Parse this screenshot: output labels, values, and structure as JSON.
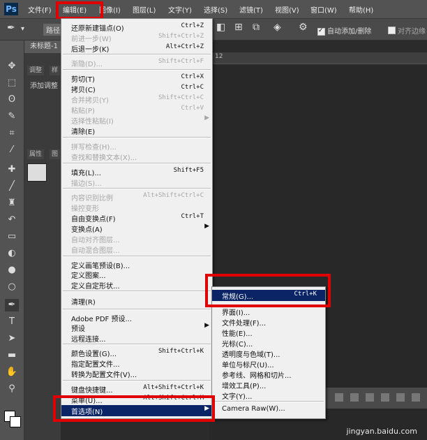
{
  "app": {
    "logo": "Ps"
  },
  "menubar": {
    "items": [
      "文件(F)",
      "编辑(E)",
      "图像(I)",
      "图层(L)",
      "文字(Y)",
      "选择(S)",
      "滤镜(T)",
      "视图(V)",
      "窗口(W)",
      "帮助(H)"
    ]
  },
  "options_bar": {
    "path_label": "路径",
    "auto_add_delete": "自动添加/删除",
    "align_edges": "对齐边缘"
  },
  "document": {
    "tab": "未标题-1",
    "ruler_mark": "12"
  },
  "panels": {
    "tab_adjust": "调整",
    "tab_style": "样",
    "add_adjust": "添加调整",
    "props_tab": "属性",
    "props_tab2": "图"
  },
  "edit_menu": {
    "items": [
      {
        "label": "还原新建锚点(O)",
        "shortcut": "Ctrl+Z",
        "disabled": false
      },
      {
        "label": "前进一步(W)",
        "shortcut": "Shift+Ctrl+Z",
        "disabled": true
      },
      {
        "label": "后退一步(K)",
        "shortcut": "Alt+Ctrl+Z",
        "disabled": false
      },
      {
        "label": "渐隐(D)...",
        "shortcut": "Shift+Ctrl+F",
        "disabled": true
      },
      {
        "label": "剪切(T)",
        "shortcut": "Ctrl+X",
        "disabled": false
      },
      {
        "label": "拷贝(C)",
        "shortcut": "Ctrl+C",
        "disabled": false
      },
      {
        "label": "合并拷贝(Y)",
        "shortcut": "Shift+Ctrl+C",
        "disabled": true
      },
      {
        "label": "粘贴(P)",
        "shortcut": "Ctrl+V",
        "disabled": true
      },
      {
        "label": "选择性粘贴(I)",
        "shortcut": "",
        "disabled": true
      },
      {
        "label": "清除(E)",
        "shortcut": "",
        "disabled": false
      },
      {
        "label": "拼写检查(H)...",
        "shortcut": "",
        "disabled": true
      },
      {
        "label": "查找和替换文本(X)...",
        "shortcut": "",
        "disabled": true
      },
      {
        "label": "填充(L)...",
        "shortcut": "Shift+F5",
        "disabled": false
      },
      {
        "label": "描边(S)...",
        "shortcut": "",
        "disabled": true
      },
      {
        "label": "内容识别比例",
        "shortcut": "Alt+Shift+Ctrl+C",
        "disabled": true
      },
      {
        "label": "操控变形",
        "shortcut": "",
        "disabled": true
      },
      {
        "label": "自由变换点(F)",
        "shortcut": "Ctrl+T",
        "disabled": false
      },
      {
        "label": "变换点(A)",
        "shortcut": "",
        "disabled": false
      },
      {
        "label": "自动对齐图层...",
        "shortcut": "",
        "disabled": true
      },
      {
        "label": "自动混合图层...",
        "shortcut": "",
        "disabled": true
      },
      {
        "label": "定义画笔预设(B)...",
        "shortcut": "",
        "disabled": false
      },
      {
        "label": "定义图案...",
        "shortcut": "",
        "disabled": false
      },
      {
        "label": "定义自定形状...",
        "shortcut": "",
        "disabled": false
      },
      {
        "label": "清理(R)",
        "shortcut": "",
        "disabled": false
      },
      {
        "label": "Adobe PDF 预设...",
        "shortcut": "",
        "disabled": false
      },
      {
        "label": "预设",
        "shortcut": "",
        "disabled": false
      },
      {
        "label": "远程连接...",
        "shortcut": "",
        "disabled": false
      },
      {
        "label": "颜色设置(G)...",
        "shortcut": "Shift+Ctrl+K",
        "disabled": false
      },
      {
        "label": "指定配置文件...",
        "shortcut": "",
        "disabled": false
      },
      {
        "label": "转换为配置文件(V)...",
        "shortcut": "",
        "disabled": false
      },
      {
        "label": "键盘快捷键...",
        "shortcut": "Alt+Shift+Ctrl+K",
        "disabled": false
      },
      {
        "label": "菜单(U)...",
        "shortcut": "Alt+Shift+Ctrl+M",
        "disabled": false
      },
      {
        "label": "首选项(N)",
        "shortcut": "",
        "disabled": false
      }
    ]
  },
  "prefs_menu": {
    "items": [
      {
        "label": "常规(G)...",
        "shortcut": "Ctrl+K"
      },
      {
        "label": "界面(I)...",
        "shortcut": ""
      },
      {
        "label": "文件处理(F)...",
        "shortcut": ""
      },
      {
        "label": "性能(E)...",
        "shortcut": ""
      },
      {
        "label": "光标(C)...",
        "shortcut": ""
      },
      {
        "label": "透明度与色域(T)...",
        "shortcut": ""
      },
      {
        "label": "单位与标尺(U)...",
        "shortcut": ""
      },
      {
        "label": "参考线、网格和切片...",
        "shortcut": ""
      },
      {
        "label": "增效工具(P)...",
        "shortcut": ""
      },
      {
        "label": "文字(Y)...",
        "shortcut": ""
      },
      {
        "label": "Camera Raw(W)...",
        "shortcut": ""
      }
    ]
  },
  "watermark": "jingyan.baidu.com",
  "colors": {
    "highlight_red": "#e00000",
    "selected_bg": "#0a2466",
    "menu_bg": "#f0f0f0"
  }
}
